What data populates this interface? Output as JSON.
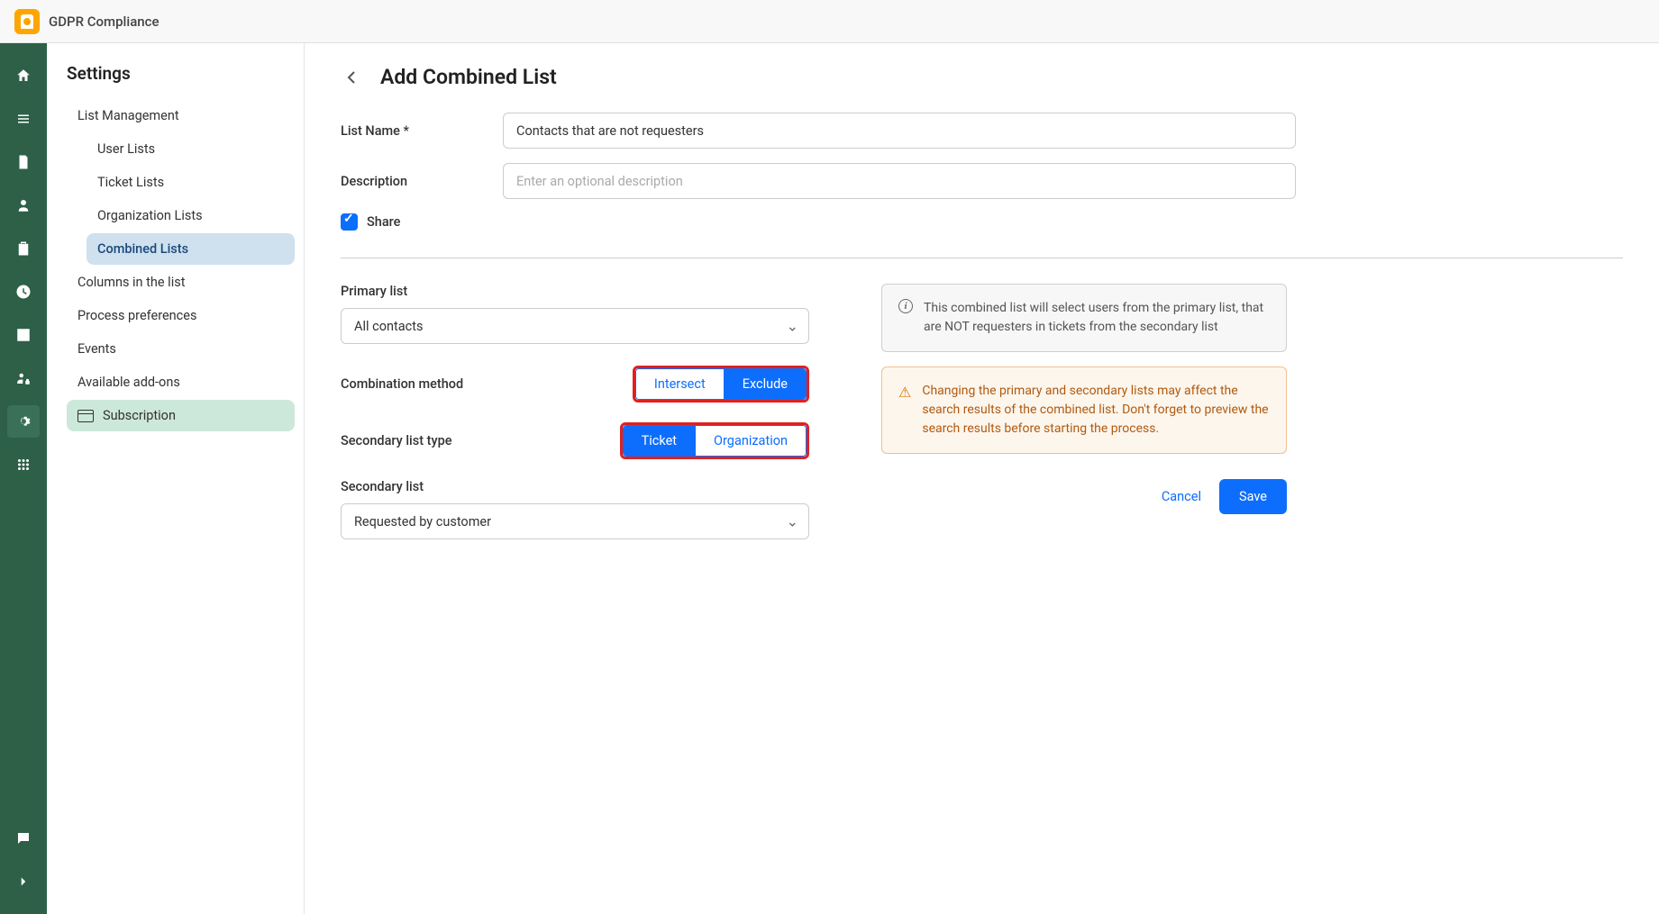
{
  "app": {
    "title": "GDPR Compliance"
  },
  "sidebar": {
    "title": "Settings",
    "items": [
      {
        "label": "List Management"
      },
      {
        "label": "User Lists"
      },
      {
        "label": "Ticket Lists"
      },
      {
        "label": "Organization Lists"
      },
      {
        "label": "Combined Lists"
      },
      {
        "label": "Columns in the list"
      },
      {
        "label": "Process preferences"
      },
      {
        "label": "Events"
      },
      {
        "label": "Available add-ons"
      },
      {
        "label": "Subscription"
      }
    ]
  },
  "page": {
    "title": "Add Combined List"
  },
  "form": {
    "listName": {
      "label": "List Name *",
      "value": "Contacts that are not requesters"
    },
    "description": {
      "label": "Description",
      "placeholder": "Enter an optional description"
    },
    "share": {
      "label": "Share",
      "checked": true
    },
    "primary": {
      "label": "Primary list",
      "value": "All contacts"
    },
    "combination": {
      "label": "Combination method",
      "intersect": "Intersect",
      "exclude": "Exclude"
    },
    "secondaryType": {
      "label": "Secondary list type",
      "ticket": "Ticket",
      "organization": "Organization"
    },
    "secondary": {
      "label": "Secondary list",
      "value": "Requested by customer"
    }
  },
  "info": {
    "text": "This combined list will select users from the primary list, that are NOT requesters in tickets from the secondary list"
  },
  "warning": {
    "text": "Changing the primary and secondary lists may affect the search results of the combined list. Don't forget to preview the search results before starting the process."
  },
  "actions": {
    "cancel": "Cancel",
    "save": "Save"
  }
}
